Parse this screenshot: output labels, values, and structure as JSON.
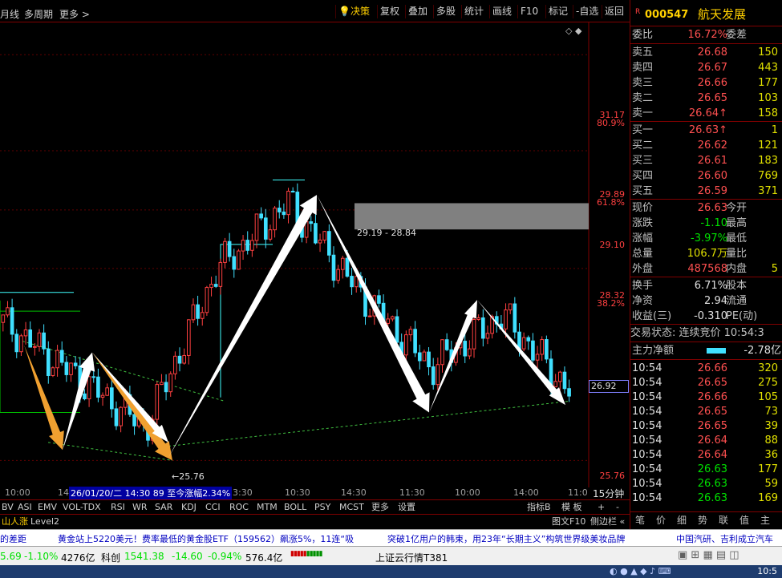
{
  "toolbar": {
    "left_items": [
      "月线",
      "多周期",
      "更多 >"
    ],
    "buttons": [
      "决策",
      "复权",
      "叠加",
      "多股",
      "统计",
      "画线",
      "F10",
      "标记",
      "-自选",
      "返回"
    ]
  },
  "stock": {
    "code": "000547",
    "name": "航天发展",
    "marker": "R"
  },
  "chart": {
    "price_labels": [
      {
        "price": "31.17",
        "pct": "80.9%"
      },
      {
        "price": "29.89",
        "pct": "61.8%"
      },
      {
        "price": "29.10",
        "pct": ""
      },
      {
        "price": "28.32",
        "pct": "38.2%"
      },
      {
        "price": "25.76",
        "pct": ""
      }
    ],
    "current_price_tag": "26.92",
    "range_annotation": "29.19 - 28.84",
    "low_annotation": "←25.76",
    "crosshair_info": "26/01/20/二 14:30 89 至今涨幅2.34%",
    "period": "15分钟",
    "time_labels": [
      "10:00",
      "14",
      "3:30",
      "10:30",
      "14:30",
      "11:30",
      "10:00",
      "14:00",
      "11:0"
    ]
  },
  "chart_data": {
    "type": "candlestick",
    "x": [
      "01/19 10:00",
      "01/19 14:00",
      "01/20 10:30",
      "01/20 14:30",
      "01/21 10:30",
      "01/21 11:30",
      "01/22 10:00",
      "01/22 14:00",
      "01/23 10:54"
    ],
    "close": [
      27.6,
      26.9,
      26.2,
      28.3,
      29.2,
      28.0,
      27.0,
      27.7,
      26.63
    ],
    "ylim": [
      25.4,
      31.6
    ],
    "annotations": [
      "29.19 - 28.84",
      "25.76"
    ]
  },
  "indicator_tabs": [
    "BV",
    "ASI",
    "EMV",
    "VOL-TDX",
    "RSI",
    "WR",
    "SAR",
    "KDJ",
    "CCI",
    "ROC",
    "MTM",
    "BOLL",
    "PSY",
    "MCST",
    "更多",
    "设置"
  ],
  "right_tabs": [
    "指标B",
    "模 板",
    "+",
    "-"
  ],
  "bottom_left_tabs": [
    "山人涨",
    "Level2"
  ],
  "bottom_right_tabs": [
    "图文F10",
    "侧边栏 «"
  ],
  "quote": {
    "weibi": {
      "label": "委比",
      "value": "16.72%",
      "label2": "委差"
    },
    "sell": [
      {
        "label": "卖五",
        "price": "26.68",
        "vol": "150"
      },
      {
        "label": "卖四",
        "price": "26.67",
        "vol": "443"
      },
      {
        "label": "卖三",
        "price": "26.66",
        "vol": "177"
      },
      {
        "label": "卖二",
        "price": "26.65",
        "vol": "103"
      },
      {
        "label": "卖一",
        "price": "26.64↑",
        "vol": "158"
      }
    ],
    "buy": [
      {
        "label": "买一",
        "price": "26.63↑",
        "vol": "1"
      },
      {
        "label": "买二",
        "price": "26.62",
        "vol": "121"
      },
      {
        "label": "买三",
        "price": "26.61",
        "vol": "183"
      },
      {
        "label": "买四",
        "price": "26.60",
        "vol": "769"
      },
      {
        "label": "买五",
        "price": "26.59",
        "vol": "371"
      }
    ],
    "stats": [
      {
        "l1": "现价",
        "v1": "26.63",
        "l2": "今开"
      },
      {
        "l1": "涨跌",
        "v1": "-1.10",
        "l2": "最高"
      },
      {
        "l1": "涨幅",
        "v1": "-3.97%",
        "l2": "最低"
      },
      {
        "l1": "总量",
        "v1": "106.7万",
        "l2": "量比"
      },
      {
        "l1": "外盘",
        "v1": "487568",
        "l2": "内盘",
        "v2": "5"
      }
    ],
    "stats2": [
      {
        "l1": "换手",
        "v1": "6.71%",
        "l2": "股本"
      },
      {
        "l1": "净资",
        "v1": "2.94",
        "l2": "流通"
      },
      {
        "l1": "收益(三)",
        "v1": "-0.310",
        "l2": "PE(动)"
      }
    ],
    "trade_state": "交易状态: 连续竞价 10:54:3",
    "main_flow": {
      "label": "主力净额",
      "value": "-2.78亿"
    },
    "ticks": [
      {
        "t": "10:54",
        "p": "26.66",
        "v": "320"
      },
      {
        "t": "10:54",
        "p": "26.65",
        "v": "275"
      },
      {
        "t": "10:54",
        "p": "26.66",
        "v": "105"
      },
      {
        "t": "10:54",
        "p": "26.65",
        "v": "73"
      },
      {
        "t": "10:54",
        "p": "26.65",
        "v": "39"
      },
      {
        "t": "10:54",
        "p": "26.64",
        "v": "88"
      },
      {
        "t": "10:54",
        "p": "26.64",
        "v": "36"
      },
      {
        "t": "10:54",
        "p": "26.63",
        "v": "177"
      },
      {
        "t": "10:54",
        "p": "26.63",
        "v": "59"
      },
      {
        "t": "10:54",
        "p": "26.63",
        "v": "169"
      }
    ],
    "bottom_tabs": [
      "笔",
      "价",
      "细",
      "势",
      "联",
      "值",
      "主"
    ]
  },
  "news": [
    "的差距",
    "黄金站上5220美元！费率最低的黄金股ETF（159562）飙涨5%，11连“吸",
    "突破1亿用户的韩束，用23年“长期主义”构筑世界级美妆品牌",
    "中国汽研、吉利成立汽车"
  ],
  "status": {
    "idx1_val": "5.69",
    "idx1_pct": "-1.10%",
    "idx1_amt": "4276亿",
    "idx2_name": "科创",
    "idx2_val": "1541.38",
    "idx2_chg": "-14.60",
    "idx2_pct": "-0.94%",
    "idx2_amt": "576.4亿",
    "feed": "上证云行情T381"
  },
  "clock": "10:5"
}
